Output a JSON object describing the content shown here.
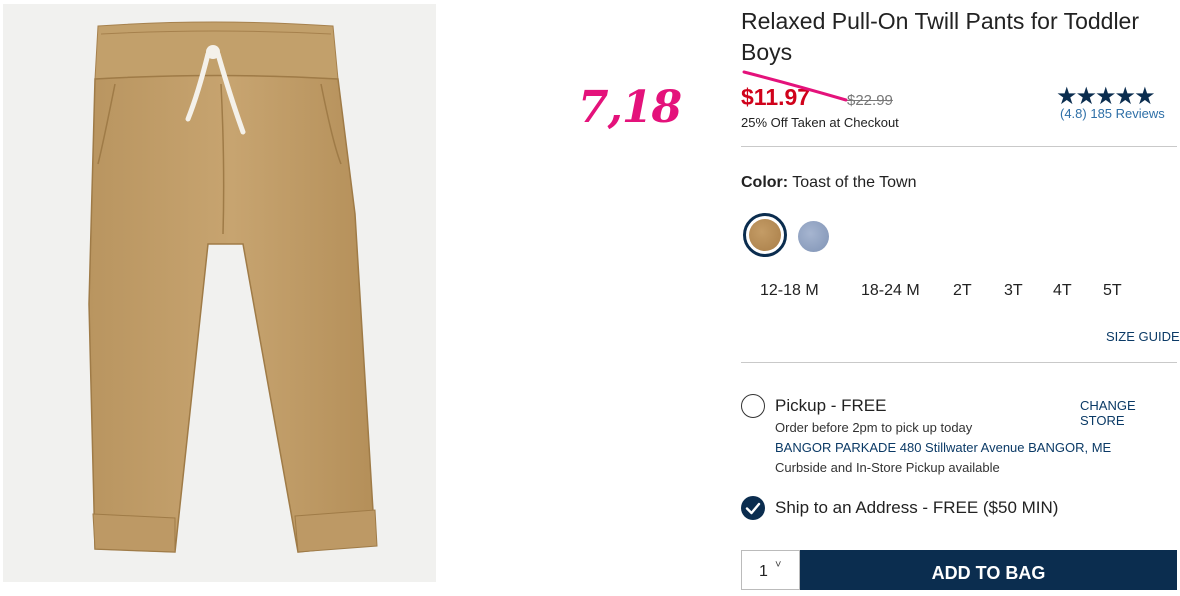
{
  "handwritten_price": "7,18",
  "product": {
    "title": "Relaxed Pull-On Twill Pants for Toddler Boys",
    "sale_price": "$11.97",
    "original_price": "$22.99",
    "promo": "25% Off Taken at Checkout",
    "rating_stars": "★★★★★",
    "reviews": "(4.8) 185 Reviews"
  },
  "color": {
    "label": "Color:",
    "value": "Toast of the Town",
    "swatches": [
      {
        "name": "Toast of the Town",
        "hex": "#b8915a",
        "selected": true
      },
      {
        "name": "chambray",
        "hex": "#8fa2c2",
        "selected": false
      }
    ]
  },
  "sizes": [
    "12-18 M",
    "18-24 M",
    "2T",
    "3T",
    "4T",
    "5T"
  ],
  "size_guide": "SIZE GUIDE",
  "fulfillment": {
    "pickup_label": "Pickup - FREE",
    "change_store": "CHANGE STORE",
    "pickup_note": "Order before 2pm to pick up today",
    "store_address": "BANGOR PARKADE 480 Stillwater Avenue  BANGOR, ME",
    "curbside_note": "Curbside and In-Store Pickup available",
    "ship_label": "Ship to an Address - FREE ($50 MIN)"
  },
  "cart": {
    "quantity": "1",
    "add_to_bag": "ADD TO BAG"
  },
  "colors": {
    "navy": "#0b2d4f",
    "sale_red": "#d0021b",
    "annotation_pink": "#e4127b",
    "link_blue": "#2e6fa7"
  }
}
